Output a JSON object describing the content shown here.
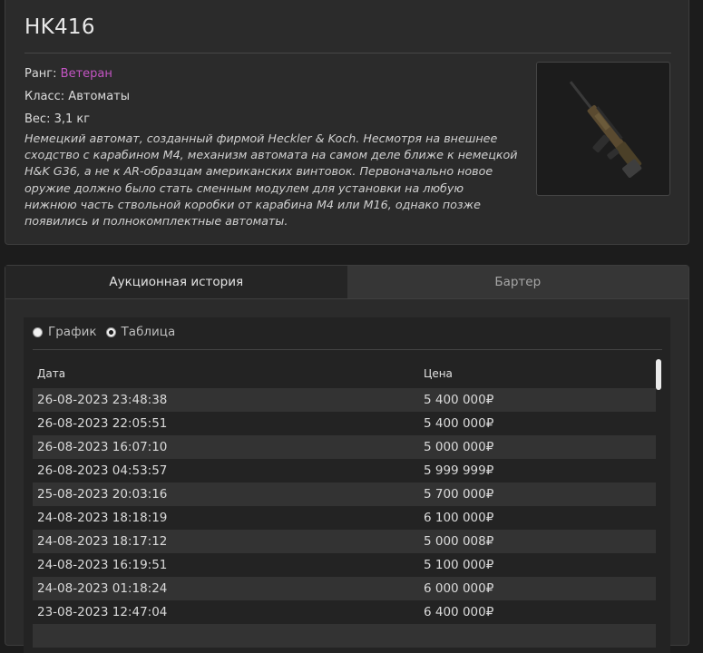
{
  "item": {
    "title": "HK416",
    "rank_label": "Ранг:",
    "rank_value": "Ветеран",
    "class_line": "Класс: Автоматы",
    "weight_line": "Вес: 3,1 кг",
    "description": "Немецкий автомат, созданный фирмой Heckler & Koch. Несмотря на внешнее сходство с карабином М4, механизм автомата на самом деле ближе к немецкой H&K G36, а не к AR-образцам американских винтовок. Первоначально новое оружие должно было стать сменным модулем для установки на любую нижнюю часть ствольной коробки от карабина М4 или М16, однако позже появились и полнокомплектные автоматы.",
    "image_icon": "rifle-image",
    "rank_color": "#c455c4"
  },
  "tabs": [
    {
      "label": "Аукционная история",
      "active": true
    },
    {
      "label": "Бартер",
      "active": false
    }
  ],
  "view_mode": {
    "options": [
      "График",
      "Таблица"
    ],
    "selected": "Таблица"
  },
  "table": {
    "headers": [
      "Дата",
      "Цена"
    ],
    "rows": [
      {
        "date": "26-08-2023 23:48:38",
        "price": "5 400 000₽"
      },
      {
        "date": "26-08-2023 22:05:51",
        "price": "5 400 000₽"
      },
      {
        "date": "26-08-2023 16:07:10",
        "price": "5 000 000₽"
      },
      {
        "date": "26-08-2023 04:53:57",
        "price": "5 999 999₽"
      },
      {
        "date": "25-08-2023 20:03:16",
        "price": "5 700 000₽"
      },
      {
        "date": "24-08-2023 18:18:19",
        "price": "6 100 000₽"
      },
      {
        "date": "24-08-2023 18:17:12",
        "price": "5 000 008₽"
      },
      {
        "date": "24-08-2023 16:19:51",
        "price": "5 100 000₽"
      },
      {
        "date": "24-08-2023 01:18:24",
        "price": "6 000 000₽"
      },
      {
        "date": "23-08-2023 12:47:04",
        "price": "6 400 000₽"
      },
      {
        "date": "",
        "price": ""
      }
    ]
  }
}
